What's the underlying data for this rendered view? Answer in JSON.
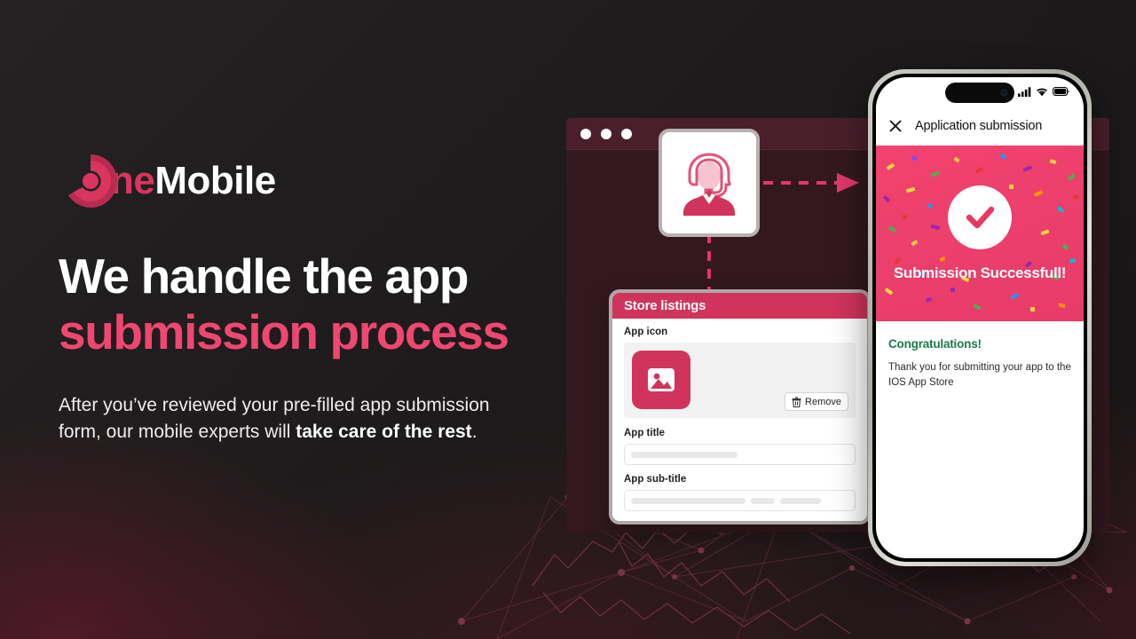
{
  "brand": {
    "logo_icon": "onemobile-circle-logo",
    "name_accent": "ne",
    "name_rest": "Mobile",
    "accent_color": "#d8355f",
    "headline_accent_color": "#ef476f"
  },
  "hero": {
    "headline_line1": "We handle the app",
    "headline_line2": "submission process",
    "body_part1": "After you’ve reviewed your pre-filled app submission form, our mobile experts will ",
    "body_bold": "take care of the rest",
    "body_part2": "."
  },
  "browser": {
    "traffic_lights": [
      "close-dot",
      "minimize-dot",
      "maximize-dot"
    ],
    "titlebar_color": "#4a1f2c",
    "body_color": "#33191f"
  },
  "agent_card": {
    "icon": "support-agent-headset-icon"
  },
  "connectors": {
    "to_phone": "dashed-arrow-right",
    "to_form": "dashed-arrow-down",
    "color": "#e0386a"
  },
  "store_listings": {
    "header": "Store listings",
    "header_color": "#d1345b",
    "app_icon_label": "App icon",
    "app_icon_glyph": "image-placeholder-icon",
    "remove_button": {
      "label": "Remove",
      "icon": "trash-icon"
    },
    "fields": [
      {
        "label": "App title",
        "value": "",
        "skeleton_widths": [
          120
        ]
      },
      {
        "label": "App sub-title",
        "value": "",
        "skeleton_widths": [
          129,
          27,
          46
        ]
      }
    ]
  },
  "phone": {
    "status": {
      "signal_icon": "cellular-signal-icon",
      "wifi_icon": "wifi-icon",
      "battery_icon": "battery-icon",
      "dynamic_island": "dynamic-island"
    },
    "app_bar": {
      "close_icon": "close-x-icon",
      "title": "Application submission"
    },
    "success_banner": {
      "check_icon": "check-circle-icon",
      "message": "Submission Successfull!",
      "background_color": "#ec3f6b",
      "confetti_colors": [
        "#ffd93d",
        "#4caf50",
        "#9c27b0",
        "#2196f3",
        "#e53935",
        "#ff9800",
        "#00bcd4"
      ]
    },
    "content": {
      "congrats_title": "Congratulations!",
      "congrats_color": "#1b7a4b",
      "body": "Thank you for submitting your app to the IOS App Store"
    }
  }
}
